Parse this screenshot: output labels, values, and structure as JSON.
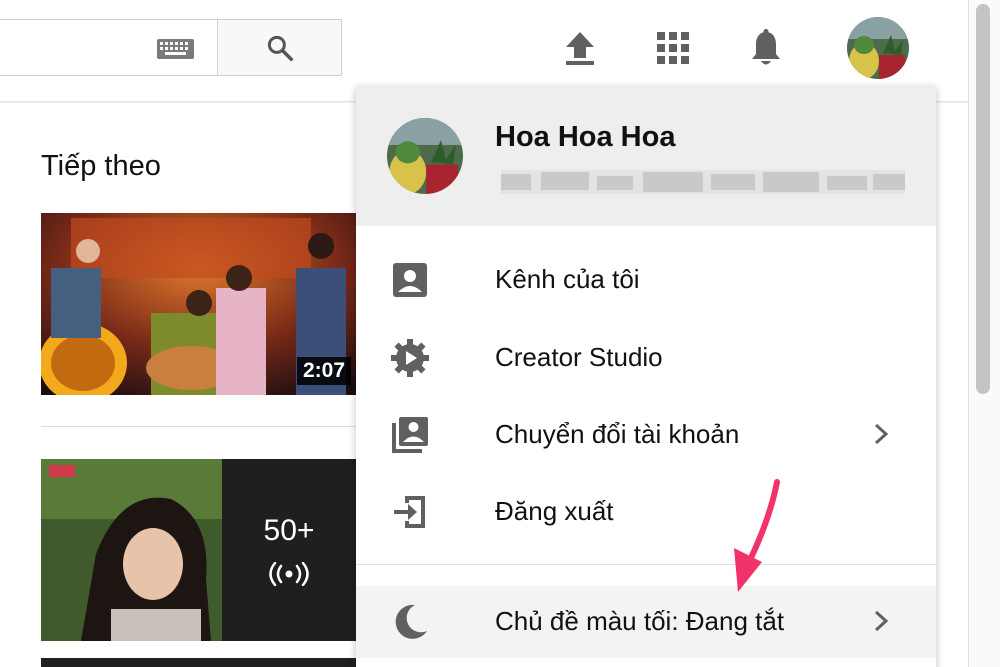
{
  "topbar": {
    "icons": [
      "keyboard-icon",
      "search-icon",
      "upload-icon",
      "apps-icon",
      "notifications-icon"
    ]
  },
  "sidebar_content": {
    "section_title": "Tiếp theo",
    "videos": [
      {
        "duration": "2:07"
      },
      {
        "overlay_count": "50+"
      }
    ]
  },
  "menu": {
    "user": {
      "name": "Hoa Hoa Hoa"
    },
    "items": [
      {
        "label": "Kênh của tôi",
        "icon": "account-box-icon"
      },
      {
        "label": "Creator Studio",
        "icon": "gear-play-icon"
      },
      {
        "label": "Chuyển đổi tài khoản",
        "icon": "switch-account-icon",
        "has_submenu": true
      },
      {
        "label": "Đăng xuất",
        "icon": "sign-out-icon"
      }
    ],
    "theme": {
      "label": "Chủ đề màu tối: Đang tắt",
      "icon": "moon-icon",
      "has_submenu": true
    }
  },
  "colors": {
    "annotation_arrow": "#f2336b",
    "icon_gray": "#606060"
  }
}
